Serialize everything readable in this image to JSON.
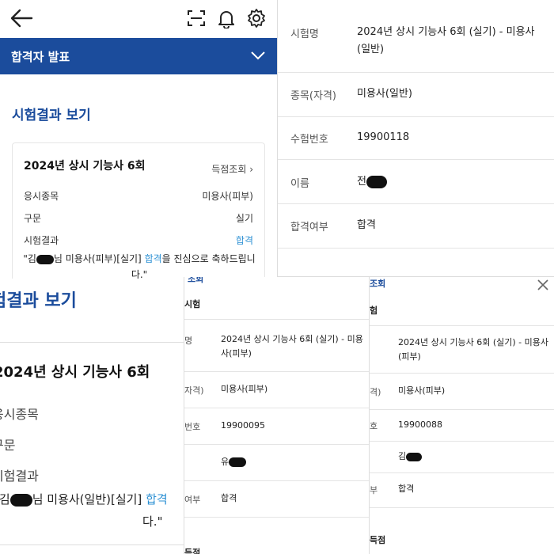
{
  "panel_top_left": {
    "banner_title": "합격자 발표",
    "section_title": "시험결과 보기",
    "card": {
      "title": "2024년 상시 기능사 6회",
      "score_link": "득점조회 ›",
      "rows": [
        {
          "label": "응시종목",
          "value": "미용사(피부)"
        },
        {
          "label": "구문",
          "value": "실기"
        },
        {
          "label": "시험결과",
          "value": "합격"
        }
      ],
      "message_prefix": "\"김",
      "message_middle": "님 미용사(피부)[실기] ",
      "message_pass": "합격",
      "message_suffix": "을 진심으로 축하드립니다.\""
    }
  },
  "panel_top_right": {
    "rows": [
      {
        "label": "시험명",
        "value": "2024년 상시 기능사 6회 (실기) - 미용사(일반)"
      },
      {
        "label": "종목(자격)",
        "value": "미용사(일반)"
      },
      {
        "label": "수험번호",
        "value": "19900118"
      },
      {
        "label": "이름",
        "value": "전"
      },
      {
        "label": "합격여부",
        "value": "합격"
      }
    ]
  },
  "panel_bottom_left": {
    "section_title": "험결과 보기",
    "card_title": "2024년 상시 기능사 6회",
    "labels": [
      "응시종목",
      "구문",
      "시험결과"
    ],
    "message_prefix": "\"김",
    "message_middle": "님 미용사(일반)[실기] ",
    "message_pass": "합격",
    "message_end": "다.\""
  },
  "panel_bottom_middle": {
    "header_fragment": "조회",
    "table_header": "시험",
    "rows": [
      {
        "label": "명",
        "value": "2024년 상시 기능사 6회 (실기) - 미용사(피부)"
      },
      {
        "label": "자격)",
        "value": "미용사(피부)"
      },
      {
        "label": "번호",
        "value": "19900095"
      },
      {
        "label": "",
        "value": "유"
      },
      {
        "label": "여부",
        "value": "합격"
      }
    ],
    "footer_fragment": "득점"
  },
  "panel_bottom_right": {
    "header_fragment": "조회",
    "table_header": "험",
    "rows": [
      {
        "label": "",
        "value": "2024년 상시 기능사 6회 (실기) - 미용사(피부)"
      },
      {
        "label": "격)",
        "value": "미용사(피부)"
      },
      {
        "label": "호",
        "value": "19900088"
      },
      {
        "label": "",
        "value": "김"
      },
      {
        "label": "부",
        "value": "합격"
      }
    ],
    "footer_fragment": "득점"
  },
  "colors": {
    "brand_blue": "#1b4c9c",
    "pass_blue": "#2a8fd3"
  },
  "icons": [
    "back-arrow-icon",
    "scan-icon",
    "bell-icon",
    "gear-icon",
    "chevron-down-icon",
    "close-icon"
  ]
}
